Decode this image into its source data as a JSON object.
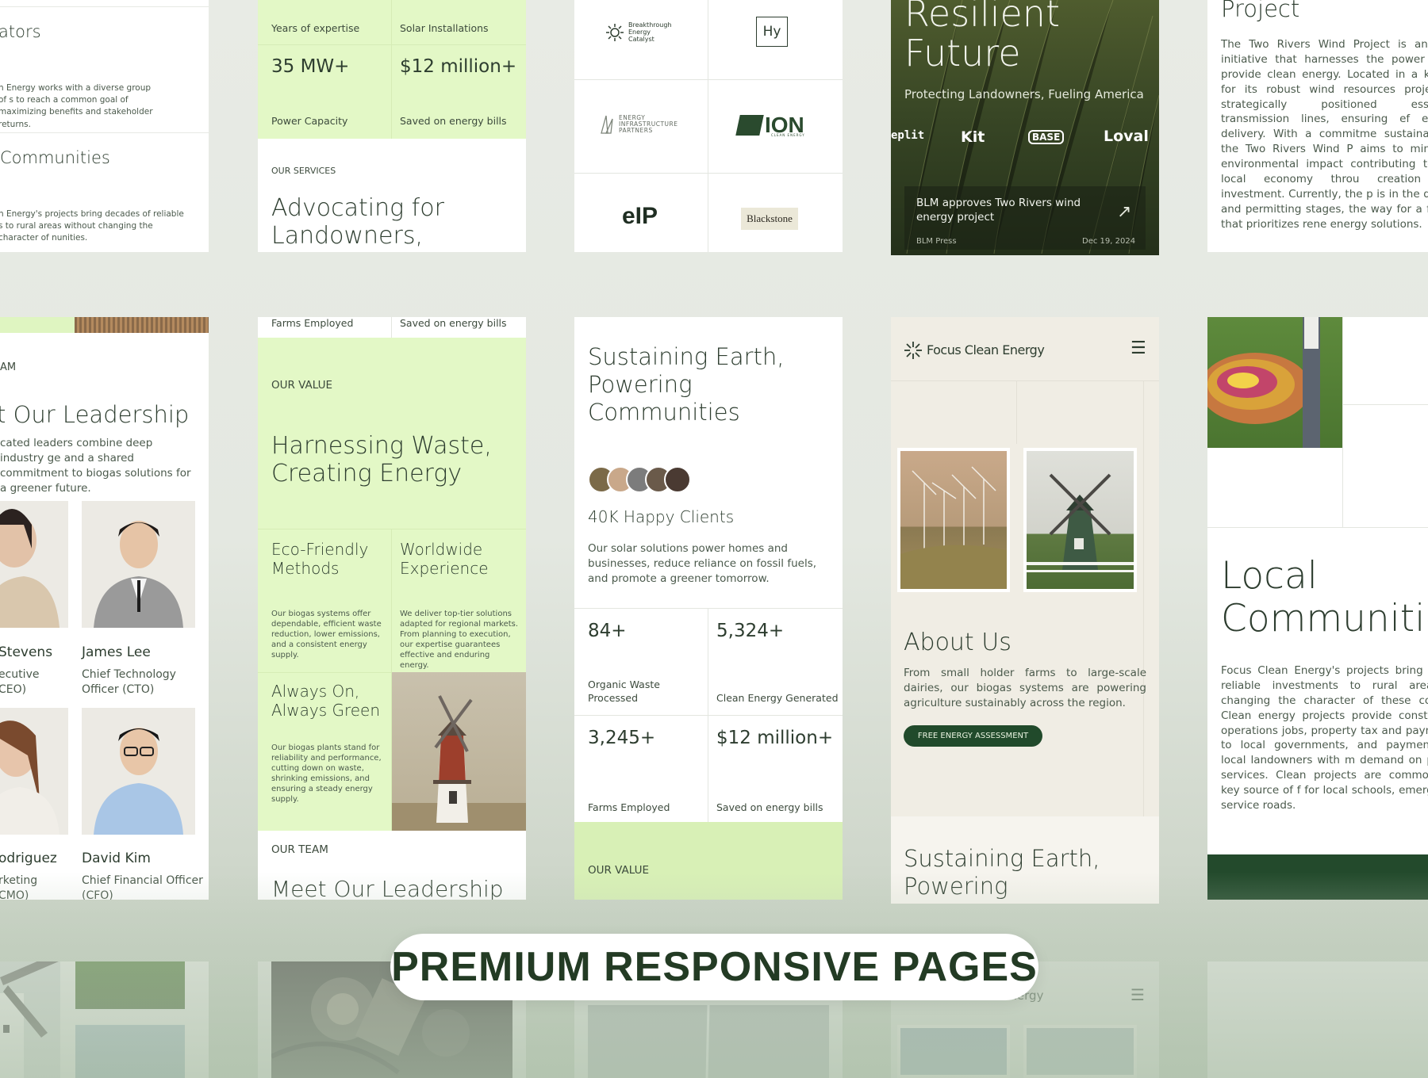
{
  "banner": "PREMIUM RESPONSIVE PAGES",
  "col1": {
    "top_title": "ators",
    "top_text": "n Energy works with a diverse group of s to reach a common goal of maximizing benefits and stakeholder returns.",
    "comm_title": "Communities",
    "comm_text": "n Energy's projects bring decades of reliable s to rural areas without changing the character of nunities.",
    "team_label": "AM",
    "team_title": "t Our Leadership",
    "team_text": "cated leaders combine deep industry ge and a shared commitment to biogas solutions for a greener future.",
    "people": [
      {
        "name": "Stevens",
        "role1": "ecutive",
        "role2": "CEO)"
      },
      {
        "name": "James Lee",
        "role1": "Chief Technology",
        "role2": "Officer (CTO)"
      },
      {
        "name": "odriguez",
        "role1": "rketing",
        "role2": "CMO)"
      },
      {
        "name": "David Kim",
        "role1": "Chief Financial Officer",
        "role2": "(CFO)"
      }
    ]
  },
  "col2": {
    "top_stats": [
      {
        "label": "Years of expertise",
        "value": "35 MW+",
        "caption": "Power Capacity"
      },
      {
        "label": "Solar Installations",
        "value": "$12 million+",
        "caption": "Saved on energy bills"
      }
    ],
    "services_label": "OUR SERVICES",
    "services_title": "Advocating for Landowners, Advising",
    "mid_captions": [
      "Farms Employed",
      "Saved on energy bills"
    ],
    "value_label": "OUR VALUE",
    "value_title": "Harnessing Waste, Creating Energy",
    "features": [
      {
        "title": "Eco-Friendly Methods",
        "text": "Our biogas systems offer dependable, efficient waste reduction, lower emissions, and a consistent energy supply."
      },
      {
        "title": "Worldwide Experience",
        "text": "We deliver top-tier solutions adapted for regional markets. From planning to execution, our expertise guarantees effective and enduring energy."
      },
      {
        "title": "Always On, Always Green",
        "text": "Our biogas plants stand for reliability and performance, cutting down on waste, shrinking emissions, and ensuring a steady energy supply."
      }
    ],
    "team_label": "OUR TEAM",
    "team_title": "Meet Our Leadership"
  },
  "col3": {
    "logos": [
      "Breakthrough Energy Catalyst",
      "Hy",
      "ENERGY INFRASTRUCTURE PARTNERS",
      "ION",
      "eIP",
      "Blackstone"
    ],
    "logo_sub_ion": "CLEAN ENERGY",
    "title": "Sustaining Earth, Powering Communities",
    "clients": "40K Happy Clients",
    "text": "Our solar solutions power homes and businesses, reduce reliance on fossil fuels, and promote a greener tomorrow.",
    "stats": [
      {
        "value": "84+",
        "caption": "Organic Waste Processed"
      },
      {
        "value": "5,324+",
        "caption": "Clean Energy Generated"
      },
      {
        "value": "3,245+",
        "caption": "Farms Employed"
      },
      {
        "value": "$12 million+",
        "caption": "Saved on energy bills"
      }
    ],
    "value_label": "OUR VALUE"
  },
  "col4": {
    "hero_title1": "Resilient",
    "hero_title2": "Future",
    "hero_sub": "Protecting Landowners, Fueling America",
    "brands": [
      "eplit",
      "Kit",
      "BASE",
      "Loval"
    ],
    "news_title": "BLM approves Two Rivers wind energy project",
    "news_source": "BLM Press",
    "news_date": "Dec 19, 2024",
    "brand_name": "Focus Clean Energy",
    "about_title": "About Us",
    "about_text": "From small holder farms to large-scale dairies, our biogas systems are powering agriculture sustainably across the region.",
    "cta": "FREE ENERGY ASSESSMENT",
    "sustain_title": "Sustaining Earth, Powering",
    "bottom_brand": "Focus Clean Energy"
  },
  "col5": {
    "project_title": "Project",
    "project_text": "The Two Rivers Wind Project is an inno initiative that harnesses the power of w provide clean energy. Located in a known for its robust wind resources project is strategically positioned essential transmission lines, ensuring ef energy delivery. With a commitme sustainability, the Two Rivers Wind P aims to minimize environmental impact contributing to the local economy throu creation and investment. Currently, the p is in the design and permitting stages, the way for a future that prioritizes rene energy solutions.",
    "local_title": "Local Communitie",
    "local_text": "Focus Clean Energy's projects bring de of reliable investments to rural areas w changing the character of these commu Clean energy projects provide constr and operations jobs, property tax and payments to local governments, and payments to local landowners with m demand on public services. Clean projects are commonly a key source of f for local schools, emergency service roads."
  }
}
